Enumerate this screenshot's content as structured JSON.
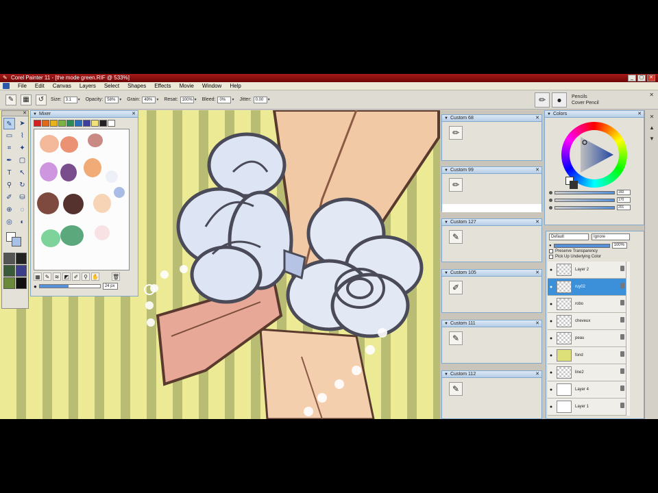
{
  "window": {
    "title": "Corel Painter 11 - [the mode green.RIF @ 533%]",
    "controls": [
      "_",
      "▢",
      "✕"
    ]
  },
  "menu": [
    "File",
    "Edit",
    "Canvas",
    "Layers",
    "Select",
    "Shapes",
    "Effects",
    "Movie",
    "Window",
    "Help"
  ],
  "property_bar": {
    "size_label": "Size:",
    "size_value": "3.1",
    "opacity_label": "Opacity:",
    "opacity_value": "58%",
    "grain_label": "Grain:",
    "grain_value": "49%",
    "resat_label": "Resat:",
    "resat_value": "100%",
    "bleed_label": "Bleed:",
    "bleed_value": "0%",
    "jitter_label": "Jitter:",
    "jitter_value": "0.00"
  },
  "brush": {
    "category": "Pencils",
    "variant": "Cover Pencil"
  },
  "mixer": {
    "title": "Mixer",
    "colors": [
      "#d42020",
      "#e06a1b",
      "#e8b21c",
      "#7cb342",
      "#2e8b57",
      "#2a6fb8",
      "#3f3f9e",
      "#f2e27a",
      "#222222",
      "#ffffff"
    ],
    "brush_size": "24 px",
    "brush_size_fraction": 0.48
  },
  "custom_palettes": [
    {
      "title": "Custom 68"
    },
    {
      "title": "Custom 99"
    },
    {
      "title": "Custom 127"
    },
    {
      "title": "Custom 105"
    },
    {
      "title": "Custom 111"
    },
    {
      "title": "Custom 112"
    }
  ],
  "colors_panel": {
    "title": "Colors",
    "rgb": [
      "160",
      "170",
      "201"
    ]
  },
  "layers_panel": {
    "composite_method": "Default",
    "composite_depth": "Ignore",
    "opacity": "100%",
    "preserve_transparency": "Preserve Transparency",
    "pick_up_underlying": "Pick Up Underlying Color",
    "layers": [
      {
        "name": "Layer 2",
        "thumb": "checker",
        "selected": false
      },
      {
        "name": "ruy02",
        "thumb": "checker",
        "selected": true
      },
      {
        "name": "robo",
        "thumb": "checker",
        "selected": false
      },
      {
        "name": "cheveux",
        "thumb": "checker",
        "selected": false
      },
      {
        "name": "peau",
        "thumb": "checker",
        "selected": false
      },
      {
        "name": "fond",
        "thumb": "yellow",
        "selected": false
      },
      {
        "name": "line2",
        "thumb": "checker",
        "selected": false
      },
      {
        "name": "Layer 4",
        "thumb": "white",
        "selected": false
      },
      {
        "name": "Layer 1",
        "thumb": "white",
        "selected": false
      }
    ]
  }
}
